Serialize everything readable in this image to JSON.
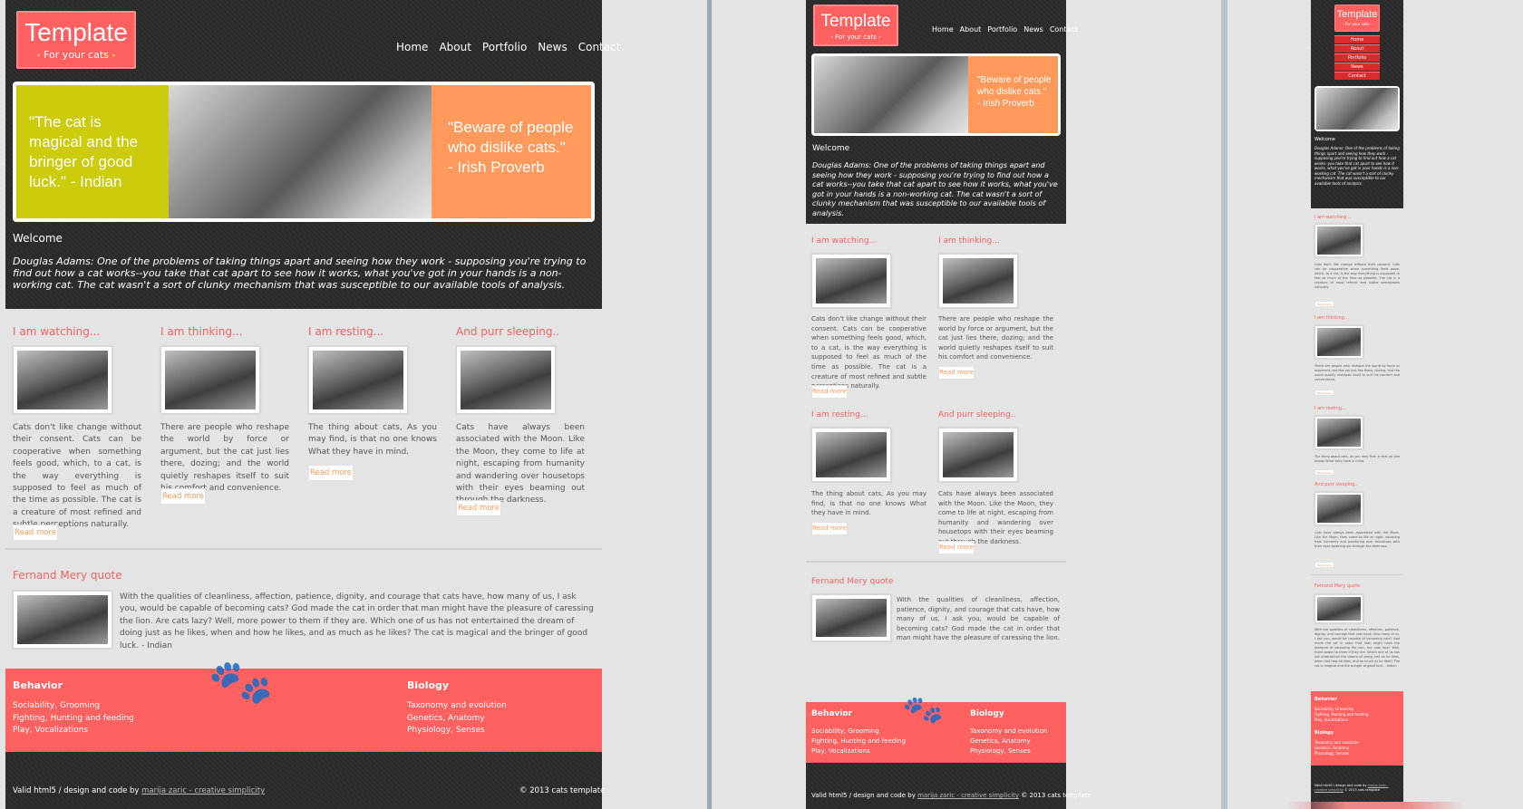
{
  "site": {
    "logo_title": "Template",
    "logo_subtitle": "- For your cats -",
    "nav": [
      "Home",
      "About",
      "Portfolio",
      "News",
      "Contact"
    ],
    "banner_quote_left": "\"The cat is magical and the bringer of good luck.\" - Indian",
    "banner_quote_right_line1": "\"Beware of people who dislike cats.\"",
    "banner_quote_right_line2": "- Irish Proverb",
    "welcome_heading": "Welcome",
    "welcome_text": "Douglas Adams: One of the problems of taking things apart and seeing how they work - supposing you're trying to find out how a cat works--you take that cat apart to see how it works, what you've got in your hands is a non-working cat. The cat wasn't a sort of clunky mechanism that was susceptible to our available tools of analysis.",
    "columns": [
      {
        "title": "I am watching...",
        "text": "Cats don't like change without their consent. Cats can be cooperative when something feels good, which, to a cat, is the way everything is supposed to feel as much of the time as possible. The cat is a creature of most refined and subtle perceptions naturally.",
        "button": "Read more"
      },
      {
        "title": "I am thinking...",
        "text": "There are people who reshape the world by force or argument, but the cat just lies there, dozing; and the world quietly reshapes itself to suit his comfort and convenience.",
        "button": "Read more"
      },
      {
        "title": "I am resting...",
        "text": "The thing about cats, As you may find, is that no one knows What they have in mind.",
        "button": "Read more"
      },
      {
        "title": "And purr sleeping..",
        "text": "Cats have always been associated with the Moon. Like the Moon, they come to life at night, escaping from humanity and wandering over housetops with their eyes beaming out through the darkness.",
        "button": "Read more"
      }
    ],
    "quote_heading": "Fernand Mery quote",
    "quote_text": "With the qualities of cleanliness, affection, patience, dignity, and courage that cats have, how many of us, I ask you, would be capable of becoming cats? God made the cat in order that man might have the pleasure of caressing the lion. Are cats lazy? Well, more power to them if they are. Which one of us has not entertained the dream of doing just as he likes, when and how he likes, and as much as he likes? The cat is magical and the bringer of good luck. - Indian",
    "footer": {
      "behavior_title": "Behavior",
      "behavior_links": [
        "Sociability, Grooming",
        "Fighting, Hunting and feeding",
        "Play, Vocalizations"
      ],
      "biology_title": "Biology",
      "biology_links": [
        "Taxonomy and evolution",
        "Genetics, Anatomy",
        "Physiology, Senses"
      ],
      "credit_prefix": "Valid html5 / design and code by",
      "credit_link": "marija zaric - creative simplicity",
      "copyright": "© 2013 cats template"
    }
  },
  "colors": {
    "accent": "#ff6161",
    "heading_red": "#f06363",
    "banner_yellow": "#cccc0c",
    "banner_orange": "#ff9a5c",
    "dark_bg": "#2a2a2a"
  },
  "icons": [
    "paw-icon"
  ]
}
